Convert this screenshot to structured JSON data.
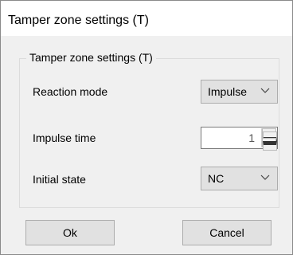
{
  "window": {
    "title": "Tamper zone settings (T)"
  },
  "group": {
    "legend": "Tamper zone settings (T)"
  },
  "reaction_mode": {
    "label": "Reaction mode",
    "value": "Impulse"
  },
  "impulse_time": {
    "label": "Impulse time",
    "value": "1"
  },
  "initial_state": {
    "label": "Initial state",
    "value": "NC"
  },
  "buttons": {
    "ok": "Ok",
    "cancel": "Cancel"
  },
  "icons": {
    "dropdown": "chevron-down-icon",
    "spin_up": "spin-up-icon",
    "spin_down": "spin-down-icon"
  }
}
